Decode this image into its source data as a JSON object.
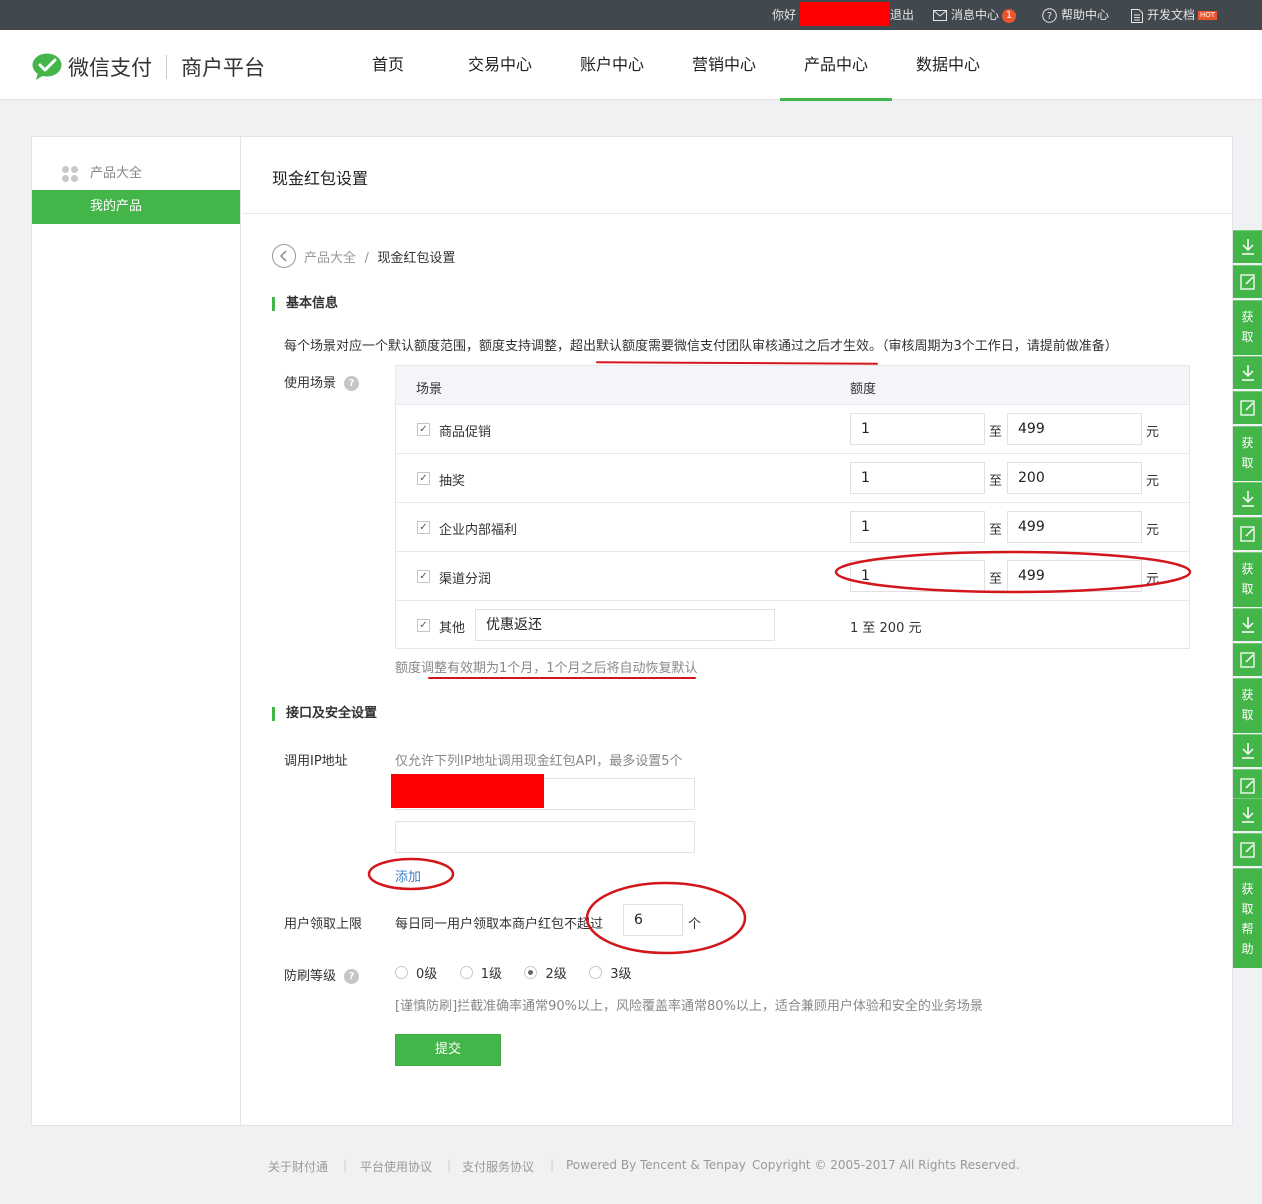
{
  "topbar": {
    "greeting": "你好",
    "logout": "退出",
    "messages": "消息中心",
    "message_count": "1",
    "help": "帮助中心",
    "docs": "开发文档",
    "hot": "HOT"
  },
  "header": {
    "brand": "微信支付",
    "subtitle": "商户平台",
    "nav": [
      "首页",
      "交易中心",
      "账户中心",
      "营销中心",
      "产品中心",
      "数据中心"
    ],
    "active_nav": "产品中心"
  },
  "sidebar": {
    "category": "产品大全",
    "active_item": "我的产品"
  },
  "page": {
    "title": "现金红包设置",
    "breadcrumb_parent": "产品大全",
    "breadcrumb_sep": "/",
    "breadcrumb_current": "现金红包设置"
  },
  "basic": {
    "section_title": "基本信息",
    "description": "每个场景对应一个默认额度范围，额度支持调整，超出默认额度需要微信支付团队审核通过之后才生效。（审核周期为3个工作日，请提前做准备）",
    "scene_label": "使用场景",
    "table": {
      "col_scene": "场景",
      "col_amount": "额度",
      "to": "至",
      "unit": "元",
      "rows": [
        {
          "name": "商品促销",
          "min": "1",
          "max": "499"
        },
        {
          "name": "抽奖",
          "min": "1",
          "max": "200"
        },
        {
          "name": "企业内部福利",
          "min": "1",
          "max": "499"
        },
        {
          "name": "渠道分润",
          "min": "1",
          "max": "499"
        }
      ],
      "other_label": "其他",
      "other_value": "优惠返还",
      "other_range": "1 至 200 元"
    },
    "note": "额度调整有效期为1个月，1个月之后将自动恢复默认"
  },
  "security": {
    "section_title": "接口及安全设置",
    "ip_label": "调用IP地址",
    "ip_hint": "仅允许下列IP地址调用现金红包API，最多设置5个",
    "add_link": "添加",
    "limit_label": "用户领取上限",
    "limit_prefix": "每日同一用户领取本商户红包不超过",
    "limit_value": "6",
    "limit_suffix": "个",
    "level_label": "防刷等级",
    "levels": [
      "0级",
      "1级",
      "2级",
      "3级"
    ],
    "selected_level": "2级",
    "level_note": "[谨慎防刷]拦截准确率通常90%以上，风险覆盖率通常80%以上，适合兼顾用户体验和安全的业务场景",
    "submit": "提交"
  },
  "rightbar": {
    "fetch": [
      "获",
      "取"
    ],
    "fetch_help": [
      "获",
      "取",
      "帮",
      "助"
    ]
  },
  "footer": {
    "about": "关于财付通",
    "platform_agreement": "平台使用协议",
    "payment_agreement": "支付服务协议",
    "powered": "Powered By Tencent & Tenpay",
    "copyright": "Copyright © 2005-2017 All Rights Reserved."
  },
  "colors": {
    "accent": "#44b549",
    "topbar": "#42494e",
    "annotation": "#d2161c",
    "redaction": "#ff0000"
  }
}
